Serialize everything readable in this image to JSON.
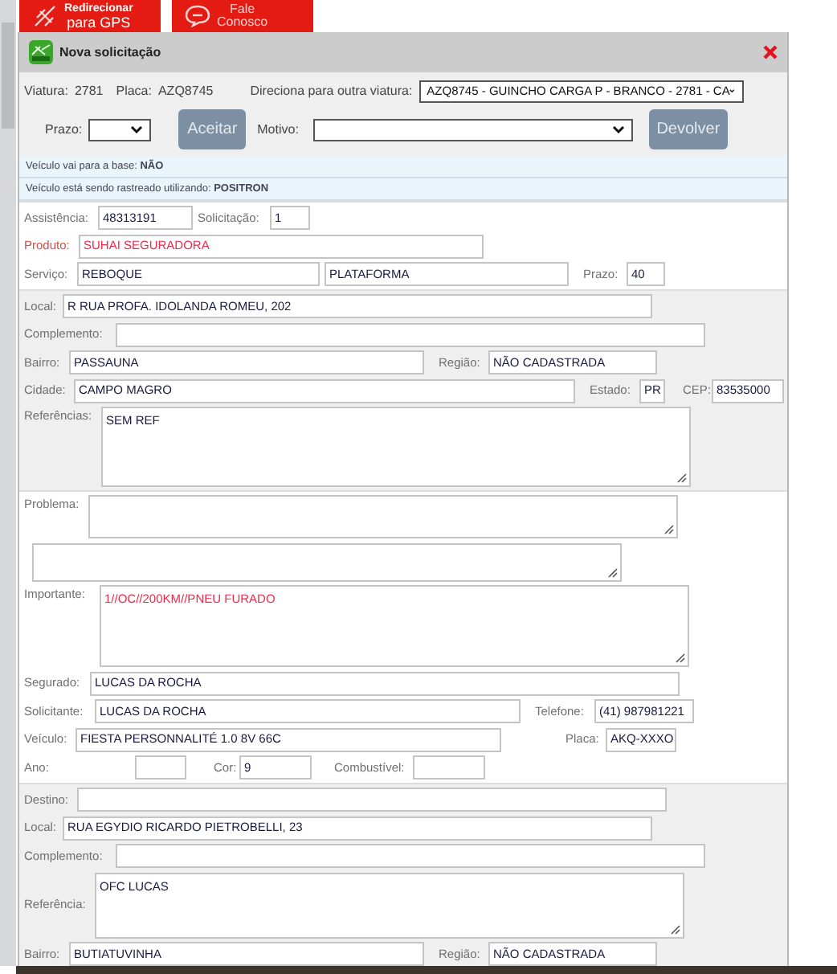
{
  "tabs": [
    {
      "kind": "gps",
      "lines": [
        "Redirecionar",
        "para GPS"
      ]
    },
    {
      "kind": "contact",
      "lines": [
        "Fale",
        "Conosco"
      ]
    }
  ],
  "dialog": {
    "title": "Nova solicitação"
  },
  "vehicle": {
    "viatura_label": "Viatura:",
    "viatura": "2781",
    "placa_label": "Placa:",
    "placa": "AZQ8745",
    "redirect_label": "Direciona para outra viatura:",
    "redirect_value": "AZQ8745 - GUINCHO CARGA P - BRANCO - 2781 - CA",
    "prazo_label": "Prazo:",
    "accept_button": "Aceitar",
    "motivo_label": "Motivo:",
    "return_button": "Devolver"
  },
  "notices": [
    "Veículo vai para a base: **NÃO**",
    "Veículo está sendo rastreado utilizando: **POSITRON**"
  ],
  "sections": [
    {
      "shaded": false,
      "rows": [
        [
          {
            "kind": "label",
            "text": "Assistência:"
          },
          {
            "kind": "input",
            "value": "48313191"
          },
          {
            "kind": "label",
            "text": "Solicitação:"
          },
          {
            "kind": "input",
            "value": "1"
          }
        ],
        [
          {
            "kind": "label",
            "text": "Produto:",
            "emphasis": true
          },
          {
            "kind": "input",
            "value": "SUHAI SEGURADORA",
            "emphasis": true
          }
        ],
        [
          {
            "kind": "label",
            "text": "Serviço:"
          },
          {
            "kind": "input",
            "value": "REBOQUE"
          },
          {
            "kind": "input",
            "value": "PLATAFORMA"
          },
          {
            "kind": "label",
            "text": "Prazo:"
          },
          {
            "kind": "input",
            "value": "40"
          }
        ]
      ]
    },
    {
      "shaded": true,
      "rows": [
        [
          {
            "kind": "label",
            "text": "Local:"
          },
          {
            "kind": "input",
            "value": "R RUA PROFA. IDOLANDA ROMEU, 202"
          }
        ],
        [
          {
            "kind": "label",
            "text": "Complemento:"
          },
          {
            "kind": "input"
          }
        ],
        [
          {
            "kind": "label",
            "text": "Bairro:"
          },
          {
            "kind": "input",
            "value": "PASSAUNA"
          },
          {
            "kind": "label",
            "text": "Região:"
          },
          {
            "kind": "input",
            "value": "NÃO CADASTRADA"
          }
        ],
        [
          {
            "kind": "label",
            "text": "Cidade:"
          },
          {
            "kind": "input",
            "value": "CAMPO MAGRO"
          },
          {
            "kind": "label",
            "text": "Estado:"
          },
          {
            "kind": "input",
            "value": "PR"
          },
          {
            "kind": "label",
            "text": "CEP:"
          },
          {
            "kind": "input",
            "value": "83535000"
          }
        ],
        [
          {
            "kind": "label",
            "text": "Referências:"
          },
          {
            "kind": "textarea",
            "value": "SEM REF"
          }
        ]
      ]
    },
    {
      "shaded": false,
      "rows": [
        [
          {
            "kind": "label",
            "text": "Problema:"
          },
          {
            "kind": "textarea"
          }
        ],
        [
          {
            "kind": "textarea"
          }
        ],
        [
          {
            "kind": "label",
            "text": "Importante:"
          },
          {
            "kind": "textarea",
            "value": "1//OC//200KM//PNEU FURADO",
            "emphasis": true
          }
        ],
        [
          {
            "kind": "label",
            "text": "Segurado:"
          },
          {
            "kind": "input",
            "value": "LUCAS DA ROCHA"
          }
        ],
        [
          {
            "kind": "label",
            "text": "Solicitante:"
          },
          {
            "kind": "input",
            "value": "LUCAS DA ROCHA"
          },
          {
            "kind": "label",
            "text": "Telefone:"
          },
          {
            "kind": "input",
            "value": "(41) 987981221"
          }
        ],
        [
          {
            "kind": "label",
            "text": "Veículo:"
          },
          {
            "kind": "input",
            "value": "FIESTA PERSONNALITÉ 1.0 8V 66C"
          },
          {
            "kind": "label",
            "text": "Placa:"
          },
          {
            "kind": "input",
            "value": "AKQ-XXXO"
          }
        ],
        [
          {
            "kind": "label",
            "text": "Ano:"
          },
          {
            "kind": "input"
          },
          {
            "kind": "label",
            "text": "Cor:"
          },
          {
            "kind": "input",
            "value": "9"
          },
          {
            "kind": "label",
            "text": "Combustível:"
          },
          {
            "kind": "input"
          }
        ]
      ]
    },
    {
      "shaded": true,
      "rows": [
        [
          {
            "kind": "label",
            "text": "Destino:"
          },
          {
            "kind": "input"
          }
        ],
        [
          {
            "kind": "label",
            "text": "Local:"
          },
          {
            "kind": "input",
            "value": "RUA EGYDIO RICARDO PIETROBELLI, 23"
          }
        ],
        [
          {
            "kind": "label",
            "text": "Complemento:"
          },
          {
            "kind": "input"
          }
        ],
        [
          {
            "kind": "label",
            "text": "Referência:"
          },
          {
            "kind": "textarea",
            "value": "OFC LUCAS"
          }
        ],
        [
          {
            "kind": "label",
            "text": "Bairro:"
          },
          {
            "kind": "input",
            "value": "BUTIATUVINHA"
          },
          {
            "kind": "label",
            "text": "Região:"
          },
          {
            "kind": "input",
            "value": "NÃO CADASTRADA"
          }
        ]
      ]
    }
  ]
}
